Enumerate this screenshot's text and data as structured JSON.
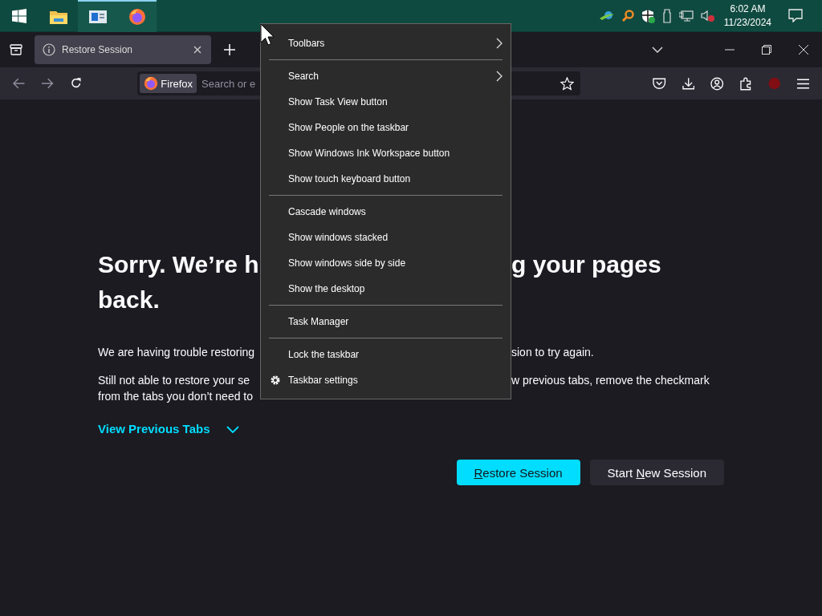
{
  "taskbar": {
    "apps": [
      {
        "kind": "folder",
        "running": false
      },
      {
        "kind": "window",
        "running": true
      },
      {
        "kind": "firefox",
        "running": true
      }
    ],
    "clock": {
      "time": "6:02 AM",
      "date": "11/23/2024"
    }
  },
  "browser": {
    "tab": {
      "title": "Restore Session",
      "selected": true
    },
    "urlbar": {
      "identity": "Firefox",
      "placeholder": "Search or e"
    }
  },
  "page": {
    "heading_lines": [
      {
        "left": "Sorry. We’re h",
        "right": "g your pages"
      },
      {
        "left": "back."
      }
    ],
    "paragraphs": [
      [
        {
          "left": "We are having trouble restoring",
          "right": "sion to try again."
        }
      ],
      [
        {
          "left": "Still not able to restore your se",
          "right": "w previous tabs, remove the checkmark"
        },
        {
          "left": "from the tabs you don’t need to"
        }
      ]
    ],
    "link": "View Previous Tabs",
    "buttons": [
      {
        "kind": "primary",
        "key": "R",
        "after": "estore Session"
      },
      {
        "kind": "secondary",
        "before": "Start ",
        "key": "N",
        "after": "ew Session"
      }
    ]
  },
  "context_menu": {
    "items": [
      {
        "kind": "item",
        "label": "Toolbars",
        "submenu": true
      },
      {
        "kind": "separator"
      },
      {
        "kind": "item",
        "label": "Search",
        "submenu": true
      },
      {
        "kind": "item",
        "label": "Show Task View button"
      },
      {
        "kind": "item",
        "label": "Show People on the taskbar"
      },
      {
        "kind": "item",
        "label": "Show Windows Ink Workspace button"
      },
      {
        "kind": "item",
        "label": "Show touch keyboard button"
      },
      {
        "kind": "separator"
      },
      {
        "kind": "item",
        "label": "Cascade windows"
      },
      {
        "kind": "item",
        "label": "Show windows stacked"
      },
      {
        "kind": "item",
        "label": "Show windows side by side"
      },
      {
        "kind": "item",
        "label": "Show the desktop"
      },
      {
        "kind": "separator"
      },
      {
        "kind": "item",
        "label": "Task Manager"
      },
      {
        "kind": "separator"
      },
      {
        "kind": "item",
        "label": "Lock the taskbar"
      },
      {
        "kind": "settings",
        "label": "Taskbar settings"
      }
    ]
  }
}
